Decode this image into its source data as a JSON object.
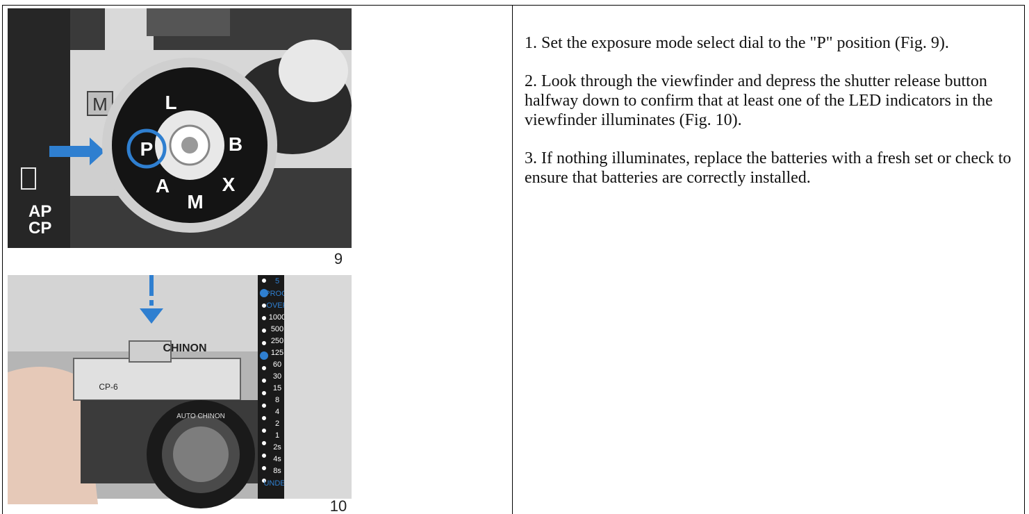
{
  "figure_9": {
    "number": "9",
    "mode_label": "M",
    "dial_letters": [
      "L",
      "P",
      "A",
      "M",
      "X",
      "B"
    ],
    "side_labels": [
      "AP",
      "CP"
    ]
  },
  "figure_10": {
    "number": "10",
    "camera_brand": "CHINON",
    "camera_model": "CP-6",
    "lens_text": "AUTO CHINON",
    "viewfinder_scale": [
      "5",
      "PROG.",
      "OVER",
      "1000",
      "500",
      "250",
      "125",
      "60",
      "30",
      "15",
      "8",
      "4",
      "2",
      "1",
      "2s",
      "4s",
      "8s",
      "UNDER"
    ]
  },
  "instructions": [
    "1. Set the exposure mode select dial to the \"P\" position (Fig. 9).",
    "2. Look through the viewfinder and depress the shutter release button halfway down to confirm that at least one of the LED indicators in the viewfinder illuminates (Fig. 10).",
    "3. If nothing illuminates, replace the batteries with a fresh set or check to ensure that batteries are correctly installed."
  ],
  "colors": {
    "accent_blue": "#2f7fd0",
    "photo_dark": "#2b2b2b",
    "photo_mid": "#8a8a8a",
    "paper": "#ffffff"
  }
}
